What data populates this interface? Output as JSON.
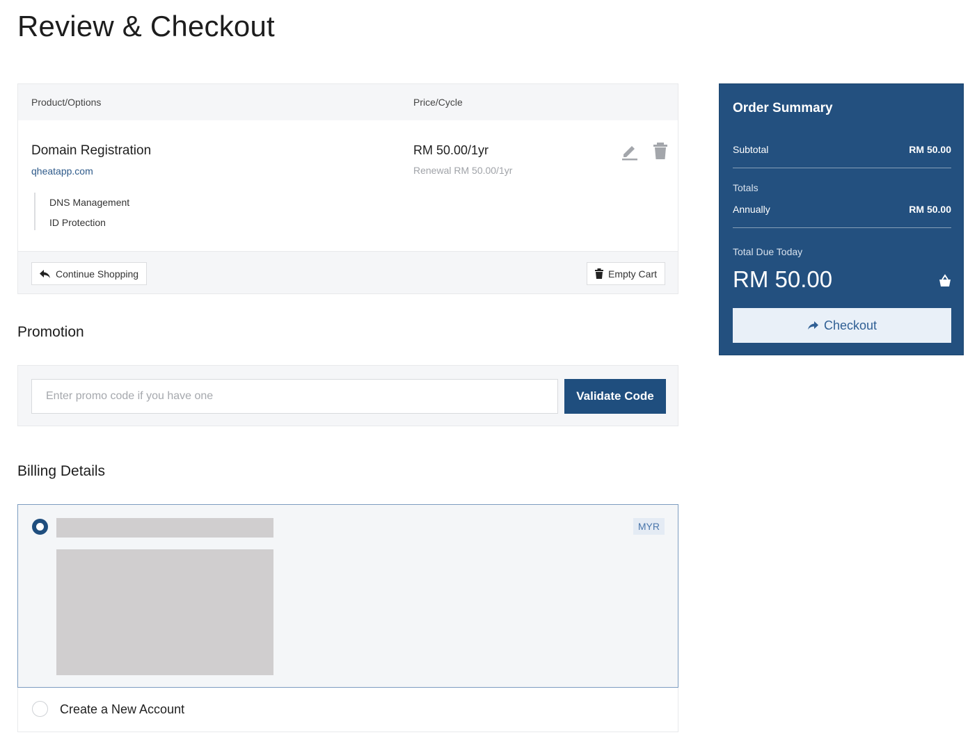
{
  "page": {
    "title": "Review & Checkout"
  },
  "cart": {
    "columns": {
      "product": "Product/Options",
      "price": "Price/Cycle"
    },
    "item": {
      "name": "Domain Registration",
      "domain": "qheatapp.com",
      "addons": [
        "DNS Management",
        "ID Protection"
      ],
      "price": "RM 50.00/1yr",
      "renewal": "Renewal RM 50.00/1yr"
    },
    "actions": {
      "continue": "Continue Shopping",
      "empty": "Empty Cart"
    }
  },
  "promotion": {
    "title": "Promotion",
    "placeholder": "Enter promo code if you have one",
    "button": "Validate Code"
  },
  "billing": {
    "title": "Billing Details",
    "currency": "MYR",
    "new_account": "Create a New Account"
  },
  "summary": {
    "title": "Order Summary",
    "subtotal_label": "Subtotal",
    "subtotal_value": "RM 50.00",
    "totals_label": "Totals",
    "annually_label": "Annually",
    "annually_value": "RM 50.00",
    "due_label": "Total Due Today",
    "due_value": "RM 50.00",
    "checkout": "Checkout"
  },
  "colors": {
    "primary": "#23507f",
    "button_dark": "#1f4e7e",
    "link": "#2e5a8a",
    "panel_bg": "#f5f6f8"
  }
}
